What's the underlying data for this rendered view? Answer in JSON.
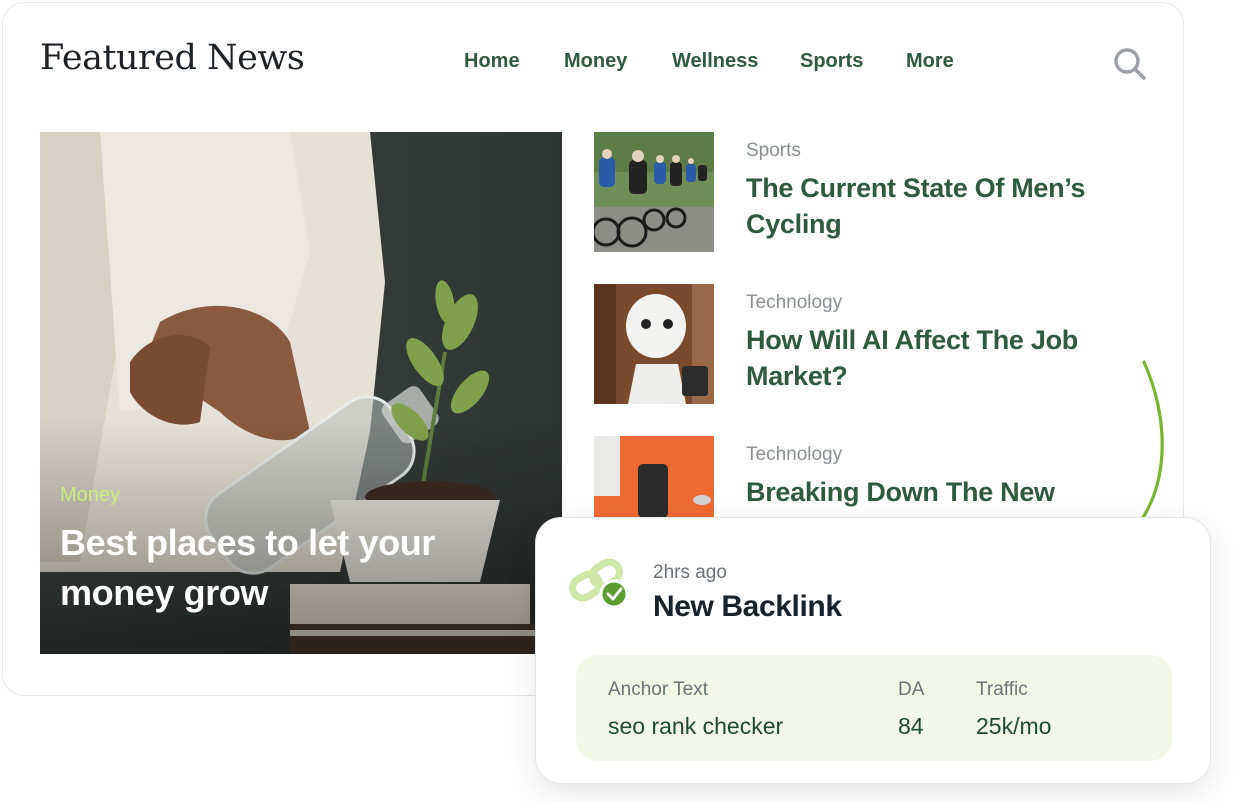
{
  "site": {
    "title": "Featured News"
  },
  "nav": {
    "items": [
      {
        "label": "Home"
      },
      {
        "label": "Money"
      },
      {
        "label": "Wellness"
      },
      {
        "label": "Sports"
      },
      {
        "label": "More"
      }
    ],
    "search_icon": "search-icon"
  },
  "hero": {
    "category": "Money",
    "title": "Best places to let your money grow",
    "tag_color": "#c8ec7f"
  },
  "articles": [
    {
      "category": "Sports",
      "title": "The Current State Of Men’s Cycling",
      "thumb": "cyclists-photo"
    },
    {
      "category": "Technology",
      "title": "How Will AI Affect The Job Market?",
      "thumb": "robot-photo"
    },
    {
      "category": "Technology",
      "title": "Breaking Down The New",
      "thumb": "phone-on-orange-photo"
    }
  ],
  "notification": {
    "time": "2hrs ago",
    "title": "New Backlink",
    "icon": "link-check-icon",
    "stats": {
      "anchor_label": "Anchor Text",
      "anchor_value": "seo rank checker",
      "da_label": "DA",
      "da_value": "84",
      "traffic_label": "Traffic",
      "traffic_value": "25k/mo"
    }
  },
  "colors": {
    "accent_green": "#2e5a40",
    "lime": "#7cb530",
    "stats_bg": "#f2f7e7"
  }
}
